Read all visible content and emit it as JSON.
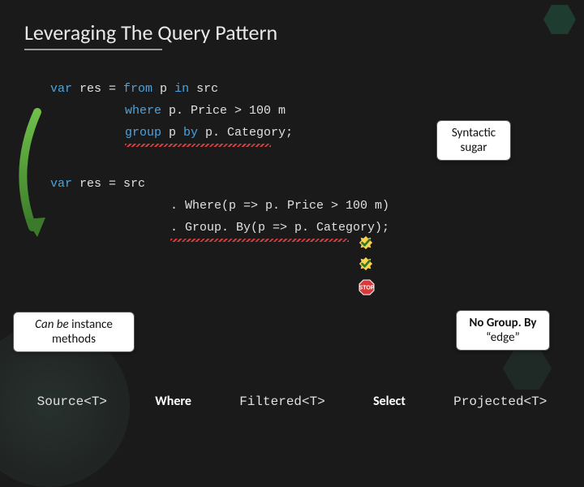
{
  "title": "Leveraging The Query Pattern",
  "code1": {
    "line1_pre": "var",
    "line1_mid": " res = ",
    "line1_kw1": "from",
    "line1_mid2": " p ",
    "line1_kw2": "in",
    "line1_post": " src",
    "line2_kw": "where",
    "line2_post": " p. Price > 100 m",
    "line3_kw1": "group",
    "line3_mid": " p ",
    "line3_kw2": "by",
    "line3_post": " p. Category;"
  },
  "code2": {
    "line1_pre": "var",
    "line1_post": " res = src",
    "line2": ". Where(p => p. Price > 100 m)",
    "line3": ". Group. By(p => p. Category);"
  },
  "callouts": {
    "sugar_l1": "Syntactic",
    "sugar_l2": "sugar",
    "instance_l1": "Can be",
    "instance_l2": " instance",
    "instance_l3": "methods",
    "edge_l1": "No Group. By",
    "edge_l2": "“edge”"
  },
  "flow": {
    "source": "Source<T>",
    "where": "Where",
    "filtered": "Filtered<T>",
    "select": "Select",
    "projected": "Projected<T>"
  },
  "icons": {
    "check1": "check-icon",
    "check2": "check-icon",
    "stop": "stop-icon"
  }
}
